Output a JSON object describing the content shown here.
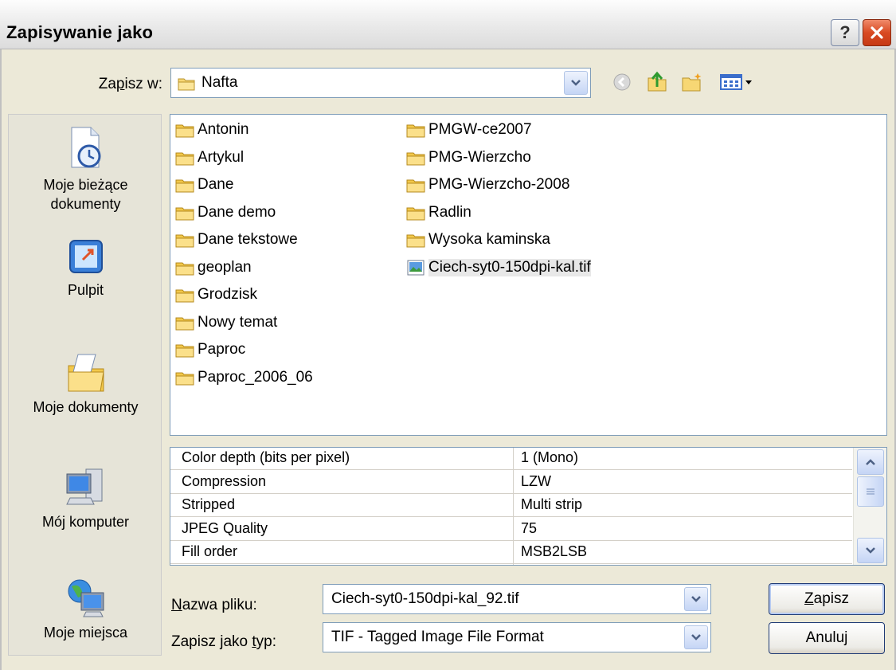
{
  "window": {
    "title": "Zapisywanie jako"
  },
  "save_in": {
    "label": "Zapisz w:",
    "value": "Nafta"
  },
  "places": [
    {
      "label": "Moje bieżące dokumenty",
      "icon": "recent-documents-icon"
    },
    {
      "label": "Pulpit",
      "icon": "desktop-icon"
    },
    {
      "label": "Moje dokumenty",
      "icon": "my-documents-icon"
    },
    {
      "label": "Mój komputer",
      "icon": "my-computer-icon"
    },
    {
      "label": "Moje miejsca",
      "icon": "network-places-icon"
    }
  ],
  "files": {
    "col1": [
      "Antonin",
      "Artykul",
      "Dane",
      "Dane demo",
      "Dane tekstowe",
      "geoplan",
      "Grodzisk",
      "Nowy temat",
      "Paproc",
      "Paproc_2006_06"
    ],
    "col2_folders": [
      "PMGW-ce2007",
      "PMG-Wierzcho",
      "PMG-Wierzcho-2008",
      "Radlin",
      "Wysoka kaminska"
    ],
    "selected_file": "Ciech-syt0-150dpi-kal.tif"
  },
  "properties": [
    {
      "name": "Color depth (bits per pixel)",
      "value": "1 (Mono)"
    },
    {
      "name": "Compression",
      "value": "LZW"
    },
    {
      "name": "Stripped",
      "value": "Multi strip"
    },
    {
      "name": "JPEG Quality",
      "value": "75"
    },
    {
      "name": "Fill order",
      "value": "MSB2LSB"
    }
  ],
  "file_name": {
    "label_u": "N",
    "label_rest": "azwa pliku:",
    "value": "Ciech-syt0-150dpi-kal_92.tif"
  },
  "file_type": {
    "label_pre": "Zapisz jako ",
    "label_u": "t",
    "label_rest": "yp:",
    "value": "TIF - Tagged Image File Format"
  },
  "buttons": {
    "save_u": "Z",
    "save_rest": "apisz",
    "cancel": "Anuluj"
  }
}
